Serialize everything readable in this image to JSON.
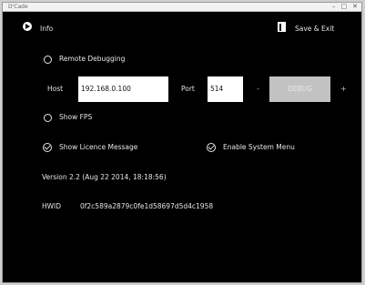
{
  "window": {
    "title": "D'Cade"
  },
  "header": {
    "info_label": "Info",
    "save_exit_label": "Save & Exit"
  },
  "remote_debugging": {
    "label": "Remote Debugging",
    "host_label": "Host",
    "host_value": "192.168.0.100",
    "port_label": "Port",
    "port_value": "514",
    "minus": "-",
    "debug_button": "DEBUG",
    "plus": "+"
  },
  "show_fps_label": "Show FPS",
  "show_licence_label": "Show Licence Message",
  "enable_menu_label": "Enable System Menu",
  "version_text": "Version 2.2 (Aug 22 2014, 18:18:56)",
  "hwid_label": "HWID",
  "hwid_value": "0f2c589a2879c0fe1d58697d5d4c1958"
}
